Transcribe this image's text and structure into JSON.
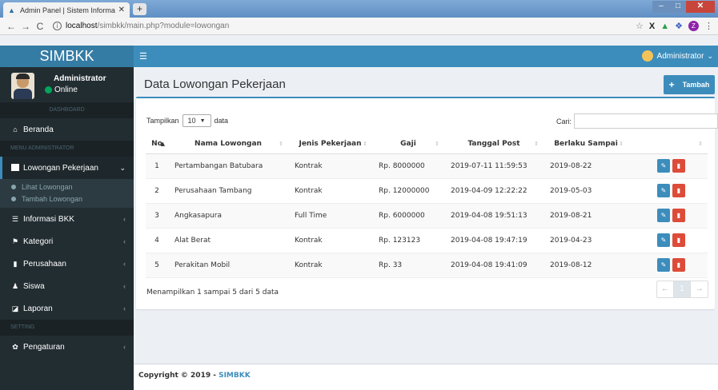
{
  "browser": {
    "tab_title": "Admin Panel | Sistem Informasi B",
    "new_tab": "+",
    "url_host": "localhost",
    "url_path": "/simbkk/main.php?module=lowongan"
  },
  "header": {
    "brand": "SIMBKK",
    "user_label": "Administrator"
  },
  "sidebar": {
    "user_name": "Administrator",
    "user_status": "Online",
    "section_dashboard": "DASHBOARD",
    "beranda": "Beranda",
    "section_admin": "MENU ADMINISTRATOR",
    "lowongan": "Lowongan Pekerjaan",
    "sub_lihat": "Lihat Lowongan",
    "sub_tambah": "Tambah Lowongan",
    "informasi": "Informasi BKK",
    "kategori": "Kategori",
    "perusahaan": "Perusahaan",
    "siswa": "Siswa",
    "laporan": "Laporan",
    "section_setting": "SETTING",
    "pengaturan": "Pengaturan"
  },
  "main": {
    "title": "Data Lowongan Pekerjaan",
    "add_label": "Tambah",
    "show_prefix": "Tampilkan",
    "show_value": "10",
    "show_suffix": "data",
    "search_label": "Cari:",
    "columns": [
      "No",
      "Nama Lowongan",
      "Jenis Pekerjaan",
      "Gaji",
      "Tanggal Post",
      "Berlaku Sampai"
    ],
    "rows": [
      {
        "no": "1",
        "nama": "Pertambangan Batubara",
        "jenis": "Kontrak",
        "gaji": "Rp. 8000000",
        "tanggal": "2019-07-11 11:59:53",
        "berlaku": "2019-08-22"
      },
      {
        "no": "2",
        "nama": "Perusahaan Tambang",
        "jenis": "Kontrak",
        "gaji": "Rp. 12000000",
        "tanggal": "2019-04-09 12:22:22",
        "berlaku": "2019-05-03"
      },
      {
        "no": "3",
        "nama": "Angkasapura",
        "jenis": "Full Time",
        "gaji": "Rp. 6000000",
        "tanggal": "2019-04-08 19:51:13",
        "berlaku": "2019-08-21"
      },
      {
        "no": "4",
        "nama": "Alat Berat",
        "jenis": "Kontrak",
        "gaji": "Rp. 123123",
        "tanggal": "2019-04-08 19:47:19",
        "berlaku": "2019-04-23"
      },
      {
        "no": "5",
        "nama": "Perakitan Mobil",
        "jenis": "Kontrak",
        "gaji": "Rp. 33",
        "tanggal": "2019-04-08 19:41:09",
        "berlaku": "2019-08-12"
      }
    ],
    "info_text": "Menampilkan 1 sampai 5 dari 5 data",
    "pager_prev": "←",
    "pager_page": "1",
    "pager_next": "→"
  },
  "footer": {
    "copyright": "Copyright © 2019 - ",
    "brand": "SIMBKK"
  },
  "colors": {
    "primary": "#3c8dbc",
    "danger": "#dd4b39",
    "sidebar": "#222d32",
    "online": "#00a65a"
  }
}
